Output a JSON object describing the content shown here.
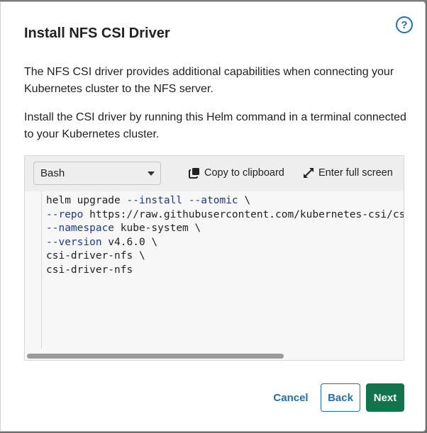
{
  "dialog": {
    "title": "Install NFS CSI Driver",
    "help_icon": "question-circle-icon",
    "help_glyph": "?",
    "intro": "The NFS CSI driver provides additional capabilities when connecting your Kubernetes cluster to the NFS server.",
    "instruction": "Install the CSI driver by running this Helm command in a terminal connected to your Kubernetes cluster."
  },
  "code_panel": {
    "language_select": {
      "selected": "Bash",
      "icon": "chevron-down-icon"
    },
    "copy": {
      "label": "Copy to clipboard",
      "icon": "copy-icon"
    },
    "fullscreen": {
      "label": "Enter full screen",
      "icon": "expand-icon"
    },
    "lines": [
      {
        "plain_before": "helm upgrade ",
        "flag": "--install",
        "between": " ",
        "flag2": "--atomic",
        "plain_after": " \\"
      },
      {
        "plain_before": "",
        "flag": "--repo",
        "between": " https://raw.githubusercontent.com/kubernetes-csi/cs",
        "flag2": "",
        "plain_after": ""
      },
      {
        "plain_before": "",
        "flag": "--namespace",
        "between": " kube-system \\",
        "flag2": "",
        "plain_after": ""
      },
      {
        "plain_before": "",
        "flag": "--version",
        "between": " v4.6.0 \\",
        "flag2": "",
        "plain_after": ""
      },
      {
        "plain_before": "csi-driver-nfs \\",
        "flag": "",
        "between": "",
        "flag2": "",
        "plain_after": ""
      },
      {
        "plain_before": "csi-driver-nfs",
        "flag": "",
        "between": "",
        "flag2": "",
        "plain_after": ""
      }
    ]
  },
  "footer": {
    "cancel_label": "Cancel",
    "back_label": "Back",
    "next_label": "Next"
  },
  "colors": {
    "accent": "#1f6fb5",
    "primary_button": "#12744d",
    "code_flag": "#1d3a8a"
  }
}
